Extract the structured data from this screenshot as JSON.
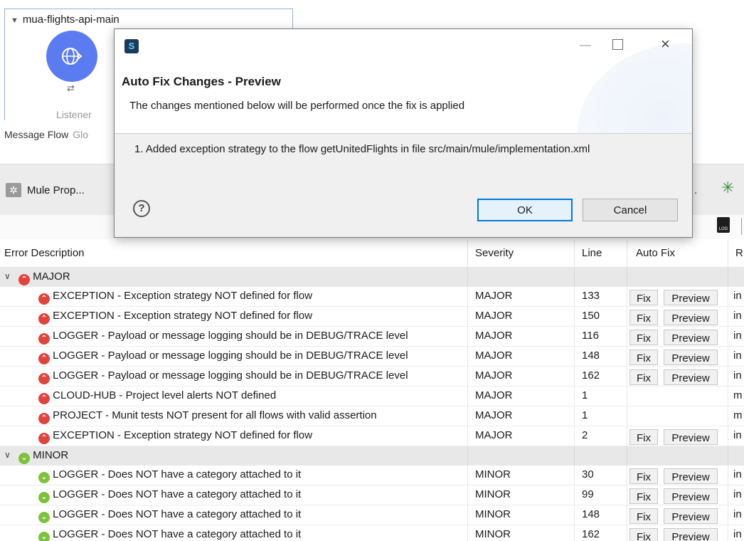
{
  "flow": {
    "title": "mua-flights-api-main",
    "listener_label": "Listener"
  },
  "subtabs": [
    "Message Flow",
    "Glo"
  ],
  "toolbar": {
    "mule_properties_label": "Mule Prop...",
    "dot": "."
  },
  "dialog": {
    "title": "Auto Fix Changes - Preview",
    "subtitle": "The changes mentioned below will be performed once the fix is applied",
    "items": [
      "1. Added exception strategy to the flow getUnitedFlights in file src/main/mule/implementation.xml"
    ],
    "ok_label": "OK",
    "cancel_label": "Cancel",
    "help_glyph": "?"
  },
  "table": {
    "columns": [
      "Error Description",
      "Severity",
      "Line",
      "Auto Fix",
      "R"
    ],
    "fix_label": "Fix",
    "preview_label": "Preview",
    "groups": [
      {
        "name": "MAJOR",
        "rows": [
          {
            "desc": "EXCEPTION - Exception strategy NOT defined for flow",
            "severity": "MAJOR",
            "line": "133",
            "autofix": true,
            "r": "in"
          },
          {
            "desc": "EXCEPTION - Exception strategy NOT defined for flow",
            "severity": "MAJOR",
            "line": "150",
            "autofix": true,
            "r": "in"
          },
          {
            "desc": "LOGGER - Payload or message logging should be in DEBUG/TRACE level",
            "severity": "MAJOR",
            "line": "116",
            "autofix": true,
            "r": "in"
          },
          {
            "desc": "LOGGER - Payload or message logging should be in DEBUG/TRACE level",
            "severity": "MAJOR",
            "line": "148",
            "autofix": true,
            "r": "in"
          },
          {
            "desc": "LOGGER - Payload or message logging should be in DEBUG/TRACE level",
            "severity": "MAJOR",
            "line": "162",
            "autofix": true,
            "r": "in"
          },
          {
            "desc": "CLOUD-HUB - Project level alerts NOT defined",
            "severity": "MAJOR",
            "line": "1",
            "autofix": false,
            "r": "m"
          },
          {
            "desc": "PROJECT - Munit tests NOT present for all flows with valid assertion",
            "severity": "MAJOR",
            "line": "1",
            "autofix": false,
            "r": "m"
          },
          {
            "desc": "EXCEPTION - Exception strategy NOT defined for flow",
            "severity": "MAJOR",
            "line": "2",
            "autofix": true,
            "r": "in"
          }
        ]
      },
      {
        "name": "MINOR",
        "rows": [
          {
            "desc": "LOGGER - Does NOT have a category attached to it",
            "severity": "MINOR",
            "line": "30",
            "autofix": true,
            "r": "in"
          },
          {
            "desc": "LOGGER - Does NOT have a category attached to it",
            "severity": "MINOR",
            "line": "99",
            "autofix": true,
            "r": "in"
          },
          {
            "desc": "LOGGER - Does NOT have a category attached to it",
            "severity": "MINOR",
            "line": "148",
            "autofix": true,
            "r": "in"
          },
          {
            "desc": "LOGGER - Does NOT have a category attached to it",
            "severity": "MINOR",
            "line": "162",
            "autofix": true,
            "r": "in"
          }
        ]
      }
    ]
  },
  "colors": {
    "major": "#e0443c",
    "minor": "#7cc23a",
    "listener": "#5b7cf0",
    "ok_border": "#0078d7"
  }
}
